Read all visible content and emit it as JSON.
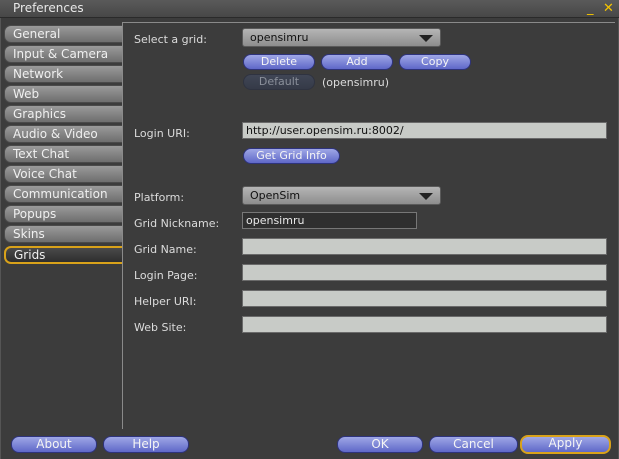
{
  "window": {
    "title": "Preferences",
    "minimize_glyph": "_",
    "close_glyph": "✕"
  },
  "tabs": [
    {
      "label": "General"
    },
    {
      "label": "Input & Camera"
    },
    {
      "label": "Network"
    },
    {
      "label": "Web"
    },
    {
      "label": "Graphics"
    },
    {
      "label": "Audio & Video"
    },
    {
      "label": "Text Chat"
    },
    {
      "label": "Voice Chat"
    },
    {
      "label": "Communication"
    },
    {
      "label": "Popups"
    },
    {
      "label": "Skins"
    },
    {
      "label": "Grids"
    }
  ],
  "active_tab": "Grids",
  "grids": {
    "select_label": "Select a grid:",
    "selected_grid": "opensimru",
    "delete_label": "Delete",
    "add_label": "Add",
    "copy_label": "Copy",
    "default_label": "Default",
    "default_value": "(opensimru)",
    "login_uri_label": "Login URI:",
    "login_uri_value": "http://user.opensim.ru:8002/",
    "get_grid_info_label": "Get Grid Info",
    "platform_label": "Platform:",
    "platform_value": "OpenSim",
    "grid_nickname_label": "Grid Nickname:",
    "grid_nickname_value": "opensimru",
    "grid_name_label": "Grid Name:",
    "grid_name_value": "",
    "login_page_label": "Login Page:",
    "login_page_value": "",
    "helper_uri_label": "Helper URI:",
    "helper_uri_value": "",
    "web_site_label": "Web Site:",
    "web_site_value": ""
  },
  "footer": {
    "about_label": "About",
    "help_label": "Help",
    "ok_label": "OK",
    "cancel_label": "Cancel",
    "apply_label": "Apply"
  },
  "colors": {
    "accent_gold": "#d9a21a",
    "button_blue": "#5f68c8",
    "window_bg": "#3c3c3c"
  }
}
